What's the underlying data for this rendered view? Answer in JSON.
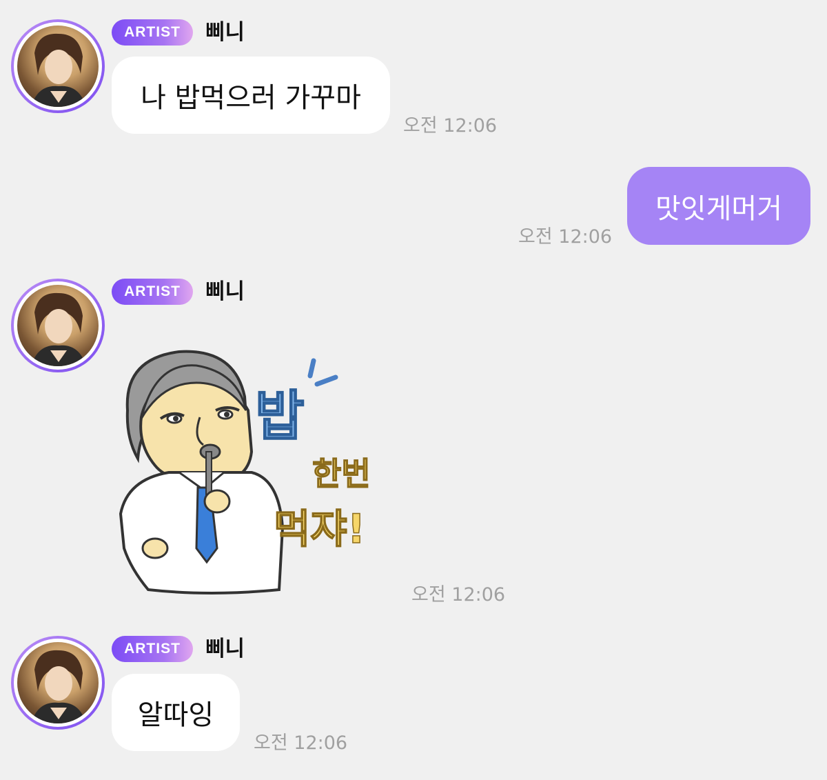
{
  "chat": {
    "messages": [
      {
        "badge": "ARTIST",
        "sender": "삐니",
        "text": "나 밥먹으러 가꾸마",
        "time": "오전 12:06"
      },
      {
        "text": "맛잇게머거",
        "time": "오전 12:06"
      },
      {
        "badge": "ARTIST",
        "sender": "삐니",
        "sticker": {
          "icon": "rice-meal-sticker",
          "line1": "밥",
          "line2": "한번",
          "line3": "먹쟈!"
        },
        "time": "오전 12:06"
      },
      {
        "badge": "ARTIST",
        "sender": "삐니",
        "text": "알따잉",
        "time": "오전 12:06"
      }
    ]
  },
  "colors": {
    "background": "#f0f0f0",
    "my_bubble": "#a584f5",
    "their_bubble": "#ffffff",
    "badge": "#7c4cf5"
  }
}
